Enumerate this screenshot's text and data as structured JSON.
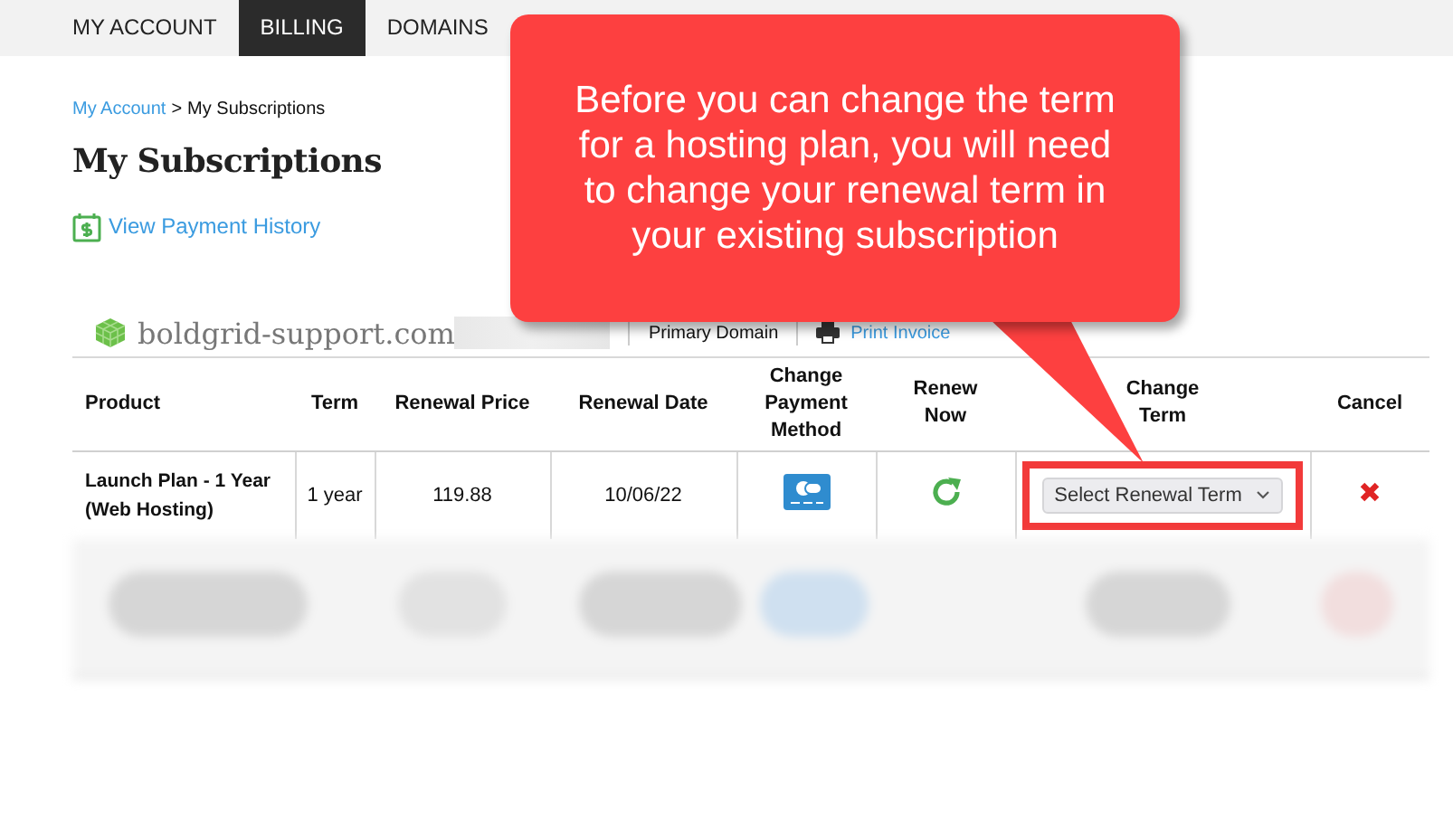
{
  "nav": {
    "tabs": [
      {
        "label": "MY ACCOUNT",
        "selected": false
      },
      {
        "label": "BILLING",
        "selected": true
      },
      {
        "label": "DOMAINS",
        "selected": false
      }
    ]
  },
  "breadcrumb": {
    "link": "My Account",
    "separator": ">",
    "current": "My Subscriptions"
  },
  "title": "My Subscriptions",
  "payment_history_link": "View Payment History",
  "domain_bar": {
    "domain": "boldgrid-support.com",
    "primary_label": "Primary Domain",
    "print_link": "Print Invoice"
  },
  "table": {
    "columns": [
      "Product",
      "Term",
      "Renewal Price",
      "Renewal Date",
      "Change Payment Method",
      "Renew Now",
      "Change Term",
      "Cancel"
    ],
    "rows": [
      {
        "product": "Launch Plan - 1 Year (Web Hosting)",
        "term": "1 year",
        "renewal_price": "119.88",
        "renewal_date": "10/06/22",
        "change_term_placeholder": "Select Renewal Term"
      }
    ]
  },
  "callout": {
    "text": "Before you can change the term for a hosting plan, you will need to change your renewal term in your existing subscription"
  }
}
